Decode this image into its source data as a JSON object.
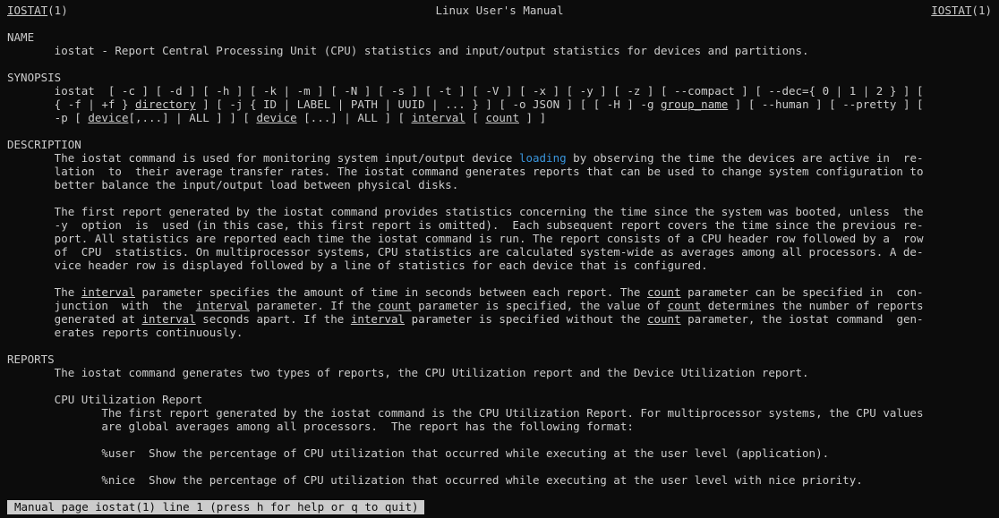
{
  "header": {
    "left": "IOSTAT",
    "left_suffix": "(1)",
    "center": "Linux User's Manual",
    "right": "IOSTAT",
    "right_suffix": "(1)"
  },
  "lines": [
    [
      {
        "t": "NAME"
      }
    ],
    [
      {
        "t": "       iostat - Report Central Processing Unit (CPU) statistics and input/output statistics for devices and partitions."
      }
    ],
    [
      {
        "t": ""
      }
    ],
    [
      {
        "t": "SYNOPSIS"
      }
    ],
    [
      {
        "t": "       iostat  [ -c ] [ -d ] [ -h ] [ -k | -m ] [ -N ] [ -s ] [ -t ] [ -V ] [ -x ] [ -y ] [ -z ] [ --compact ] [ --dec={ 0 | 1 | 2 } ] ["
      }
    ],
    [
      {
        "t": "       { -f | +f } "
      },
      {
        "t": "directory",
        "s": "u"
      },
      {
        "t": " ] [ -j { ID | LABEL | PATH | UUID | ... } ] [ -o JSON ] [ [ -H ] -g "
      },
      {
        "t": "group_name",
        "s": "u"
      },
      {
        "t": " ] [ --human ] [ --pretty ] ["
      }
    ],
    [
      {
        "t": "       -p [ "
      },
      {
        "t": "device",
        "s": "u"
      },
      {
        "t": "[,...] | ALL ] ] [ "
      },
      {
        "t": "device",
        "s": "u"
      },
      {
        "t": " [...] | ALL ] [ "
      },
      {
        "t": "interval",
        "s": "u"
      },
      {
        "t": " [ "
      },
      {
        "t": "count",
        "s": "u"
      },
      {
        "t": " ] ]"
      }
    ],
    [
      {
        "t": ""
      }
    ],
    [
      {
        "t": "DESCRIPTION"
      }
    ],
    [
      {
        "t": "       The iostat command is used for monitoring system input/output device "
      },
      {
        "t": "loading",
        "s": "hl"
      },
      {
        "t": " by observing the time the devices are active in  re-"
      }
    ],
    [
      {
        "t": "       lation  to  their average transfer rates. The iostat command generates reports that can be used to change system configuration to"
      }
    ],
    [
      {
        "t": "       better balance the input/output load between physical disks."
      }
    ],
    [
      {
        "t": ""
      }
    ],
    [
      {
        "t": "       The first report generated by the iostat command provides statistics concerning the time since the system was booted, unless  the"
      }
    ],
    [
      {
        "t": "       -y  option  is  used (in this case, this first report is omitted).  Each subsequent report covers the time since the previous re-"
      }
    ],
    [
      {
        "t": "       port. All statistics are reported each time the iostat command is run. The report consists of a CPU header row followed by a  row"
      }
    ],
    [
      {
        "t": "       of  CPU  statistics. On multiprocessor systems, CPU statistics are calculated system-wide as averages among all processors. A de-"
      }
    ],
    [
      {
        "t": "       vice header row is displayed followed by a line of statistics for each device that is configured."
      }
    ],
    [
      {
        "t": ""
      }
    ],
    [
      {
        "t": "       The "
      },
      {
        "t": "interval",
        "s": "u"
      },
      {
        "t": " parameter specifies the amount of time in seconds between each report. The "
      },
      {
        "t": "count",
        "s": "u"
      },
      {
        "t": " parameter can be specified in  con-"
      }
    ],
    [
      {
        "t": "       junction  with  the  "
      },
      {
        "t": "interval",
        "s": "u"
      },
      {
        "t": " parameter. If the "
      },
      {
        "t": "count",
        "s": "u"
      },
      {
        "t": " parameter is specified, the value of "
      },
      {
        "t": "count",
        "s": "u"
      },
      {
        "t": " determines the number of reports"
      }
    ],
    [
      {
        "t": "       generated at "
      },
      {
        "t": "interval",
        "s": "u"
      },
      {
        "t": " seconds apart. If the "
      },
      {
        "t": "interval",
        "s": "u"
      },
      {
        "t": " parameter is specified without the "
      },
      {
        "t": "count",
        "s": "u"
      },
      {
        "t": " parameter, the iostat command  gen-"
      }
    ],
    [
      {
        "t": "       erates reports continuously."
      }
    ],
    [
      {
        "t": ""
      }
    ],
    [
      {
        "t": "REPORTS"
      }
    ],
    [
      {
        "t": "       The iostat command generates two types of reports, the CPU Utilization report and the Device Utilization report."
      }
    ],
    [
      {
        "t": ""
      }
    ],
    [
      {
        "t": "       CPU Utilization Report"
      }
    ],
    [
      {
        "t": "              The first report generated by the iostat command is the CPU Utilization Report. For multiprocessor systems, the CPU values"
      }
    ],
    [
      {
        "t": "              are global averages among all processors.  The report has the following format:"
      }
    ],
    [
      {
        "t": ""
      }
    ],
    [
      {
        "t": "              %user  Show the percentage of CPU utilization that occurred while executing at the user level (application)."
      }
    ],
    [
      {
        "t": ""
      }
    ],
    [
      {
        "t": "              %nice  Show the percentage of CPU utilization that occurred while executing at the user level with nice priority."
      }
    ]
  ],
  "status_line": "Manual page iostat(1) line 1 (press h for help or q to quit)",
  "colors": {
    "background": "#0c0c0c",
    "foreground": "#cccccc",
    "link": "#3a96dd",
    "status_bg": "#cccccc"
  }
}
